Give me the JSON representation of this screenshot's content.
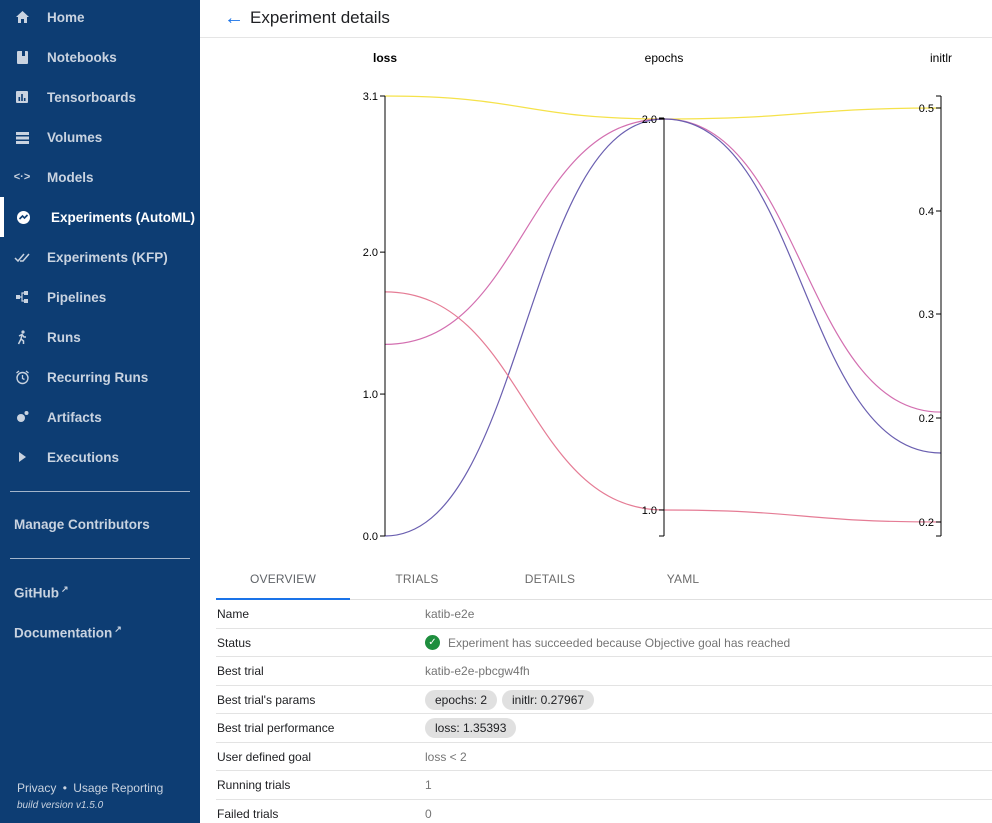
{
  "sidebar": {
    "items": [
      {
        "label": "Home",
        "icon": "home-icon"
      },
      {
        "label": "Notebooks",
        "icon": "notebook-icon"
      },
      {
        "label": "Tensorboards",
        "icon": "chart-icon"
      },
      {
        "label": "Volumes",
        "icon": "storage-icon"
      },
      {
        "label": "Models",
        "icon": "code-arrows-icon"
      },
      {
        "label": "Experiments (AutoML)",
        "icon": "experiments-automl-icon"
      },
      {
        "label": "Experiments (KFP)",
        "icon": "experiments-kfp-icon"
      },
      {
        "label": "Pipelines",
        "icon": "pipelines-icon"
      },
      {
        "label": "Runs",
        "icon": "runs-icon"
      },
      {
        "label": "Recurring Runs",
        "icon": "alarm-icon"
      },
      {
        "label": "Artifacts",
        "icon": "artifacts-icon"
      },
      {
        "label": "Executions",
        "icon": "play-icon"
      }
    ],
    "active_index": 5,
    "manage_contributors": "Manage Contributors",
    "github": "GitHub",
    "documentation": "Documentation",
    "privacy": "Privacy",
    "separator": "•",
    "usage_reporting": "Usage Reporting",
    "build_version": "build version v1.5.0"
  },
  "header": {
    "back_icon": "arrow-back-icon",
    "title": "Experiment details"
  },
  "chart_data": {
    "type": "parallel-coordinates",
    "axes": [
      {
        "name": "loss",
        "ticks": [
          "0.0",
          "1.0",
          "2.0",
          "3.1"
        ],
        "range": [
          0,
          3.1
        ]
      },
      {
        "name": "epochs",
        "ticks": [
          "1.0",
          "2.0"
        ],
        "range": [
          1,
          2
        ]
      },
      {
        "name": "initlr",
        "ticks": [
          "0.2",
          "0.2",
          "0.3",
          "0.4",
          "0.5"
        ],
        "range": [
          0.2,
          0.5
        ]
      }
    ],
    "series": [
      {
        "values": [
          3.1,
          2.0,
          0.5
        ],
        "color": "#f5e24a"
      },
      {
        "values": [
          1.35,
          2.0,
          0.27967
        ],
        "color": "#d36fb0"
      },
      {
        "values": [
          0.0,
          2.0,
          0.25
        ],
        "color": "#6a5fb0"
      },
      {
        "values": [
          1.72,
          1.0,
          0.2
        ],
        "color": "#e57c95"
      }
    ]
  },
  "tabs": [
    "OVERVIEW",
    "TRIALS",
    "DETAILS",
    "YAML"
  ],
  "active_tab": 0,
  "overview": {
    "name_key": "Name",
    "name_val": "katib-e2e",
    "status_key": "Status",
    "status_icon": "check-circle-icon",
    "status_val": "Experiment has succeeded because Objective goal has reached",
    "best_trial_key": "Best trial",
    "best_trial_val": "katib-e2e-pbcgw4fh",
    "best_params_key": "Best trial's params",
    "best_params": [
      "epochs: 2",
      "initlr: 0.27967"
    ],
    "best_perf_key": "Best trial performance",
    "best_perf": [
      "loss: 1.35393"
    ],
    "goal_key": "User defined goal",
    "goal_val": "loss < 2",
    "running_key": "Running trials",
    "running_val": "1",
    "failed_key": "Failed trials",
    "failed_val": "0"
  }
}
